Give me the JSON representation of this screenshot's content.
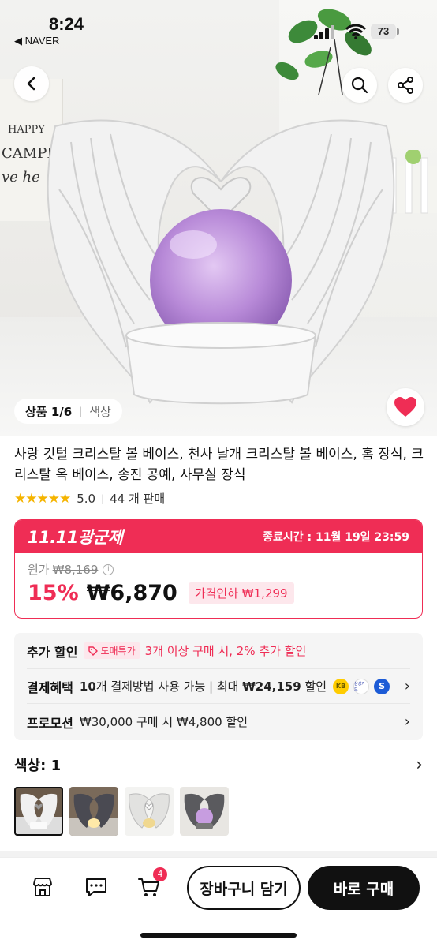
{
  "status_bar": {
    "time": "8:24",
    "back_app": "◀ NAVER",
    "battery": "73"
  },
  "hero": {
    "sign_lines": [
      "HAPPY",
      "CAMPERS",
      "ve he"
    ],
    "counter_main": "상품 1/6",
    "counter_sub": "색상"
  },
  "product": {
    "title": "사랑 깃털 크리스탈 볼 베이스, 천사 날개 크리스탈 볼 베이스, 홈 장식, 크리스탈 옥 베이스, 송진 공예, 사무실 장식",
    "stars": "★★★★★",
    "rating": "5.0",
    "sold": "44 개 판매"
  },
  "promo": {
    "logo": "11.11광군제",
    "end_time": "종료시간 : 11월 19일 23:59",
    "original_label": "원가",
    "original_price": "₩8,169",
    "info_icon": "i",
    "discount": "15%",
    "price": "₩6,870",
    "price_drop": "가격인하 ₩1,299"
  },
  "benefits": {
    "extra_label": "추가 할인",
    "extra_tag": "도매특가",
    "extra_text": "3개 이상 구매 시, 2% 추가 할인",
    "pay_label": "결제혜택",
    "pay_count": "10",
    "pay_text_a": "개 결제방법 사용 가능 | 최대 ",
    "pay_max": "₩24,159",
    "pay_text_b": " 할인",
    "promo_label": "프로모션",
    "promo_text": "₩30,000 구매 시 ₩4,800 할인",
    "card_kb": "KB",
    "card_samsung": "삼성카드"
  },
  "options": {
    "label": "색상: 1"
  },
  "bottom": {
    "cart_badge": "4",
    "cart_button": "장바구니 담기",
    "buy_button": "바로 구매"
  },
  "colors": {
    "accent": "#ef2d55",
    "star": "#f5b400"
  }
}
